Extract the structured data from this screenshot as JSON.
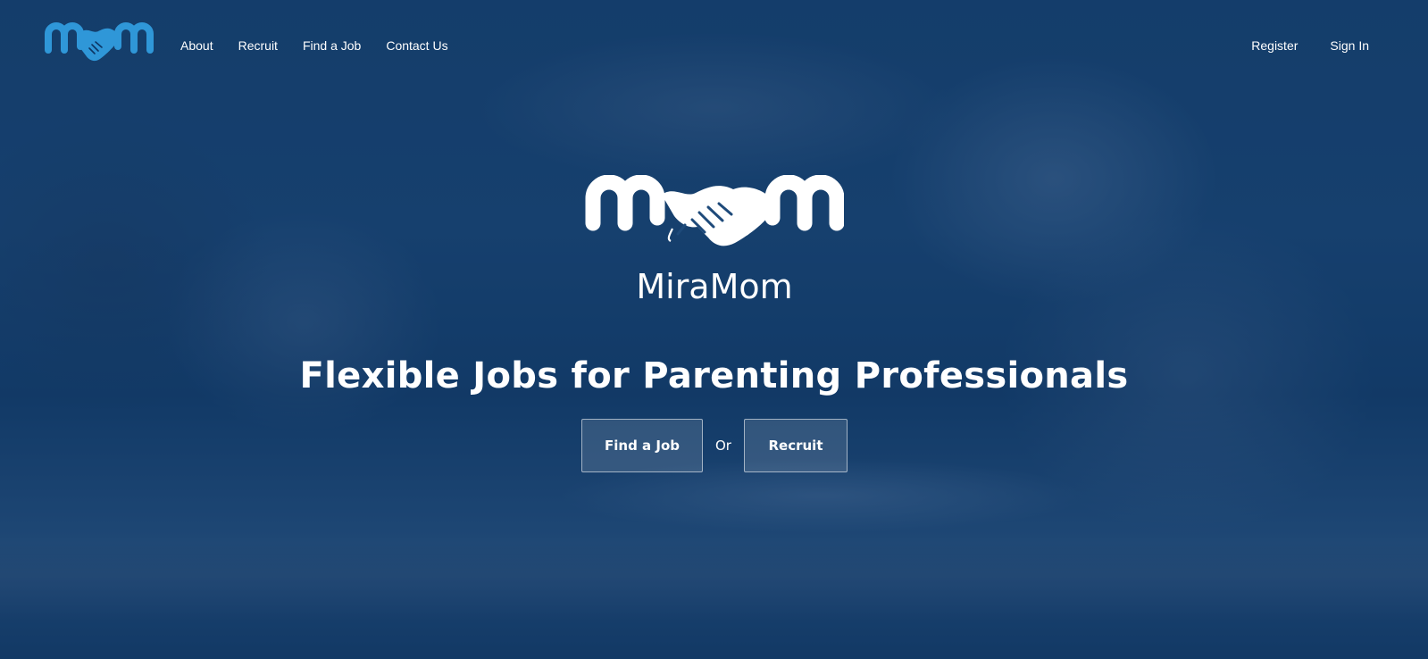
{
  "brand": {
    "name": "MiraMom",
    "logo_icon": "mom-handshake-logo",
    "logo_color": "#2f97d8",
    "logo_color_light": "#ffffff"
  },
  "nav": {
    "links": [
      {
        "label": "About"
      },
      {
        "label": "Recruit"
      },
      {
        "label": "Find a Job"
      },
      {
        "label": "Contact Us"
      }
    ],
    "register_label": "Register",
    "signin_label": "Sign In"
  },
  "hero": {
    "title": "Flexible Jobs for Parenting Professionals",
    "find_job_label": "Find a Job",
    "or_label": "Or",
    "recruit_label": "Recruit",
    "overlay_color": "#0d3563"
  }
}
